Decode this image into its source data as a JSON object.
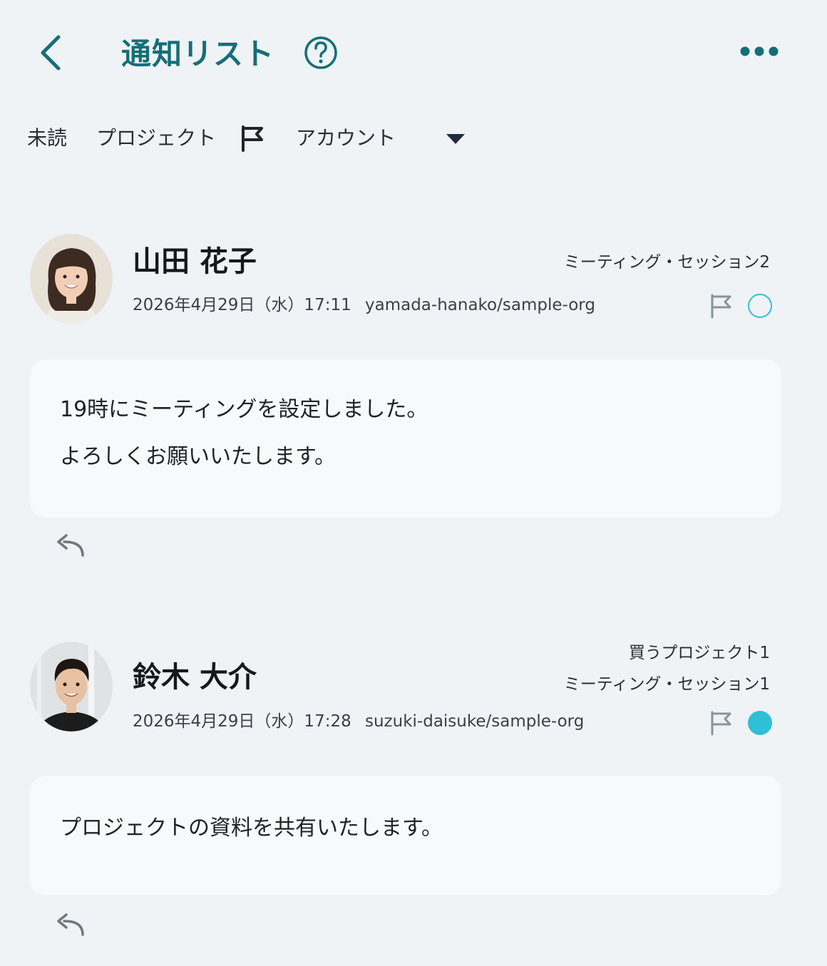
{
  "header": {
    "title": "通知リスト",
    "back_icon": "chevron-left-icon",
    "help_icon": "help-circle-icon",
    "more_icon": "more-horizontal-icon",
    "accent_color": "#156e77"
  },
  "filters": {
    "unread": "未読",
    "project": "プロジェクト",
    "flag_icon": "flag-icon",
    "account": "アカウント",
    "dropdown_icon": "caret-down-icon"
  },
  "notifications": [
    {
      "name": "山田 花子",
      "datetime": "2026年4月29日（水）17:11",
      "source": "yamada-hanako/sample-org",
      "tags": [
        "ミーティング・セッション2"
      ],
      "read": false,
      "lines": [
        "19時にミーティングを設定しました。",
        "よろしくお願いいたします。"
      ]
    },
    {
      "name": "鈴木 大介",
      "datetime": "2026年4月29日（水）17:28",
      "source": "suzuki-daisuke/sample-org",
      "tags": [
        "買うプロジェクト1",
        "ミーティング・セッション1"
      ],
      "read": true,
      "lines": [
        "プロジェクトの資料を共有いたします。"
      ]
    }
  ],
  "colors": {
    "background": "#eff3f6",
    "bubble": "#f7f9fb",
    "status_dot": "#2fbfd6"
  }
}
